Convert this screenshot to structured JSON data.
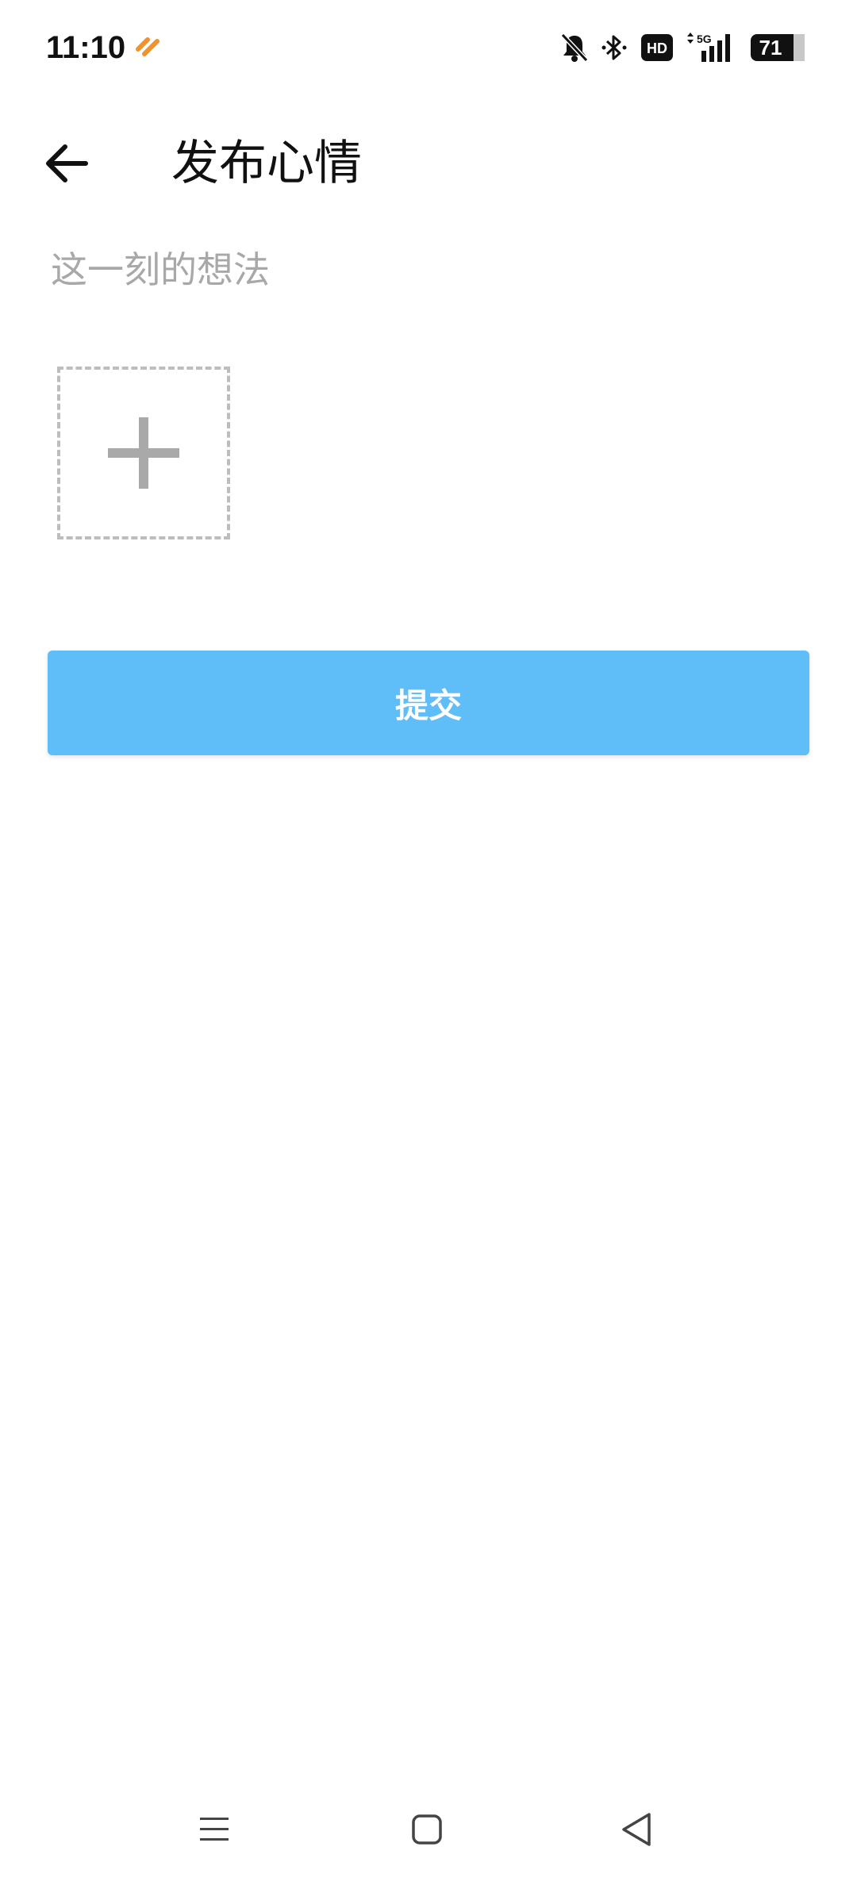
{
  "status_bar": {
    "time": "11:10",
    "app_icon": "heart-link-icon",
    "icons": [
      "bell-off-icon",
      "bluetooth-icon",
      "hd-icon",
      "5g-signal-icon",
      "battery-icon"
    ],
    "network": "5G",
    "hd_label": "HD",
    "battery_level": "71",
    "accent_color": "#f0932b"
  },
  "toolbar": {
    "back_icon": "arrow-left-icon",
    "title": "发布心情"
  },
  "form": {
    "placeholder": "这一刻的想法",
    "add_photo_icon": "plus-icon",
    "submit_label": "提交",
    "submit_color": "#5fbdf7"
  },
  "nav_bar": {
    "icons": [
      "menu-icon",
      "home-icon",
      "back-triangle-icon"
    ]
  }
}
